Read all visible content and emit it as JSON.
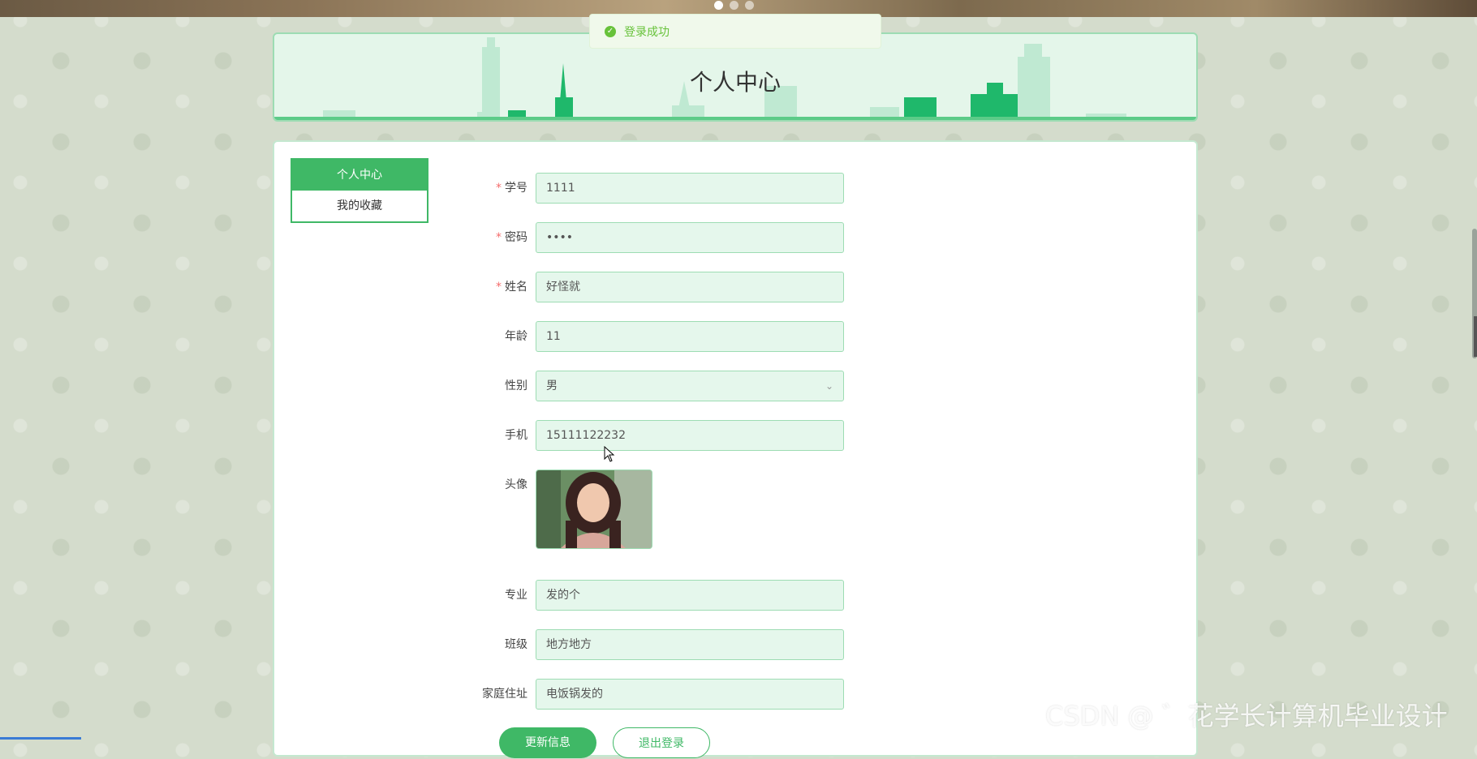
{
  "toast": {
    "text": "登录成功",
    "icon": "check-circle-icon",
    "color": "#67c23a"
  },
  "banner": {
    "dots": 3,
    "active_dot": 0
  },
  "header": {
    "title": "个人中心"
  },
  "sidebar": {
    "items": [
      {
        "label": "个人中心",
        "active": true
      },
      {
        "label": "我的收藏",
        "active": false
      }
    ]
  },
  "form": {
    "student_id": {
      "label": "学号",
      "required": true,
      "value": "1111"
    },
    "password": {
      "label": "密码",
      "required": true,
      "value": "••••"
    },
    "name": {
      "label": "姓名",
      "required": true,
      "value": "好怪就"
    },
    "age": {
      "label": "年龄",
      "required": false,
      "value": "11"
    },
    "gender": {
      "label": "性别",
      "required": false,
      "value": "男"
    },
    "phone": {
      "label": "手机",
      "required": false,
      "value": "15111122232"
    },
    "avatar": {
      "label": "头像",
      "required": false
    },
    "major": {
      "label": "专业",
      "required": false,
      "value": "发的个"
    },
    "class": {
      "label": "班级",
      "required": false,
      "value": "地方地方"
    },
    "address": {
      "label": "家庭住址",
      "required": false,
      "value": "电饭锅发的"
    }
  },
  "buttons": {
    "update": "更新信息",
    "logout": "退出登录"
  },
  "watermark": "CSDN @ ゛花学长计算机毕业设计",
  "colors": {
    "accent": "#3fb866",
    "field_bg": "#e5f7ec",
    "field_border": "#9ddcb3",
    "required": "#f56c6c"
  }
}
